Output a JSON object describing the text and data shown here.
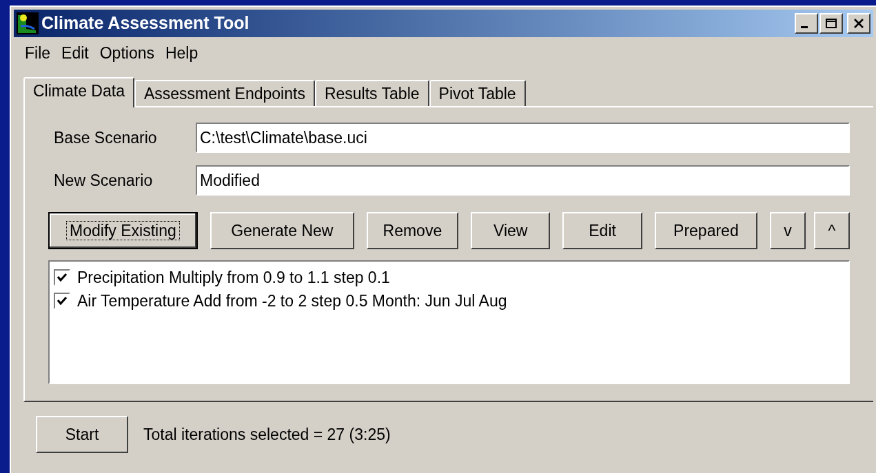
{
  "window": {
    "title": "Climate Assessment Tool"
  },
  "menu": [
    "File",
    "Edit",
    "Options",
    "Help"
  ],
  "tabs": [
    {
      "label": "Climate Data",
      "selected": true
    },
    {
      "label": "Assessment Endpoints",
      "selected": false
    },
    {
      "label": "Results Table",
      "selected": false
    },
    {
      "label": "Pivot Table",
      "selected": false
    }
  ],
  "fields": [
    {
      "label": "Base Scenario",
      "value": "C:\\test\\Climate\\base.uci"
    },
    {
      "label": "New Scenario",
      "value": "Modified"
    }
  ],
  "buttons": [
    {
      "label": "Modify Existing",
      "focused": true
    },
    {
      "label": "Generate New",
      "focused": false
    },
    {
      "label": "Remove",
      "focused": false
    },
    {
      "label": "View",
      "focused": false
    },
    {
      "label": "Edit",
      "focused": false
    },
    {
      "label": "Prepared",
      "focused": false
    }
  ],
  "move_buttons": [
    "v",
    "^"
  ],
  "items": [
    {
      "text": "Precipitation Multiply from 0.9 to 1.1 step 0.1",
      "checked": true
    },
    {
      "text": "Air Temperature Add from -2 to 2 step 0.5 Month: Jun Jul Aug",
      "checked": true
    }
  ],
  "start_button": "Start",
  "status": "Total iterations selected = 27 (3:25)"
}
